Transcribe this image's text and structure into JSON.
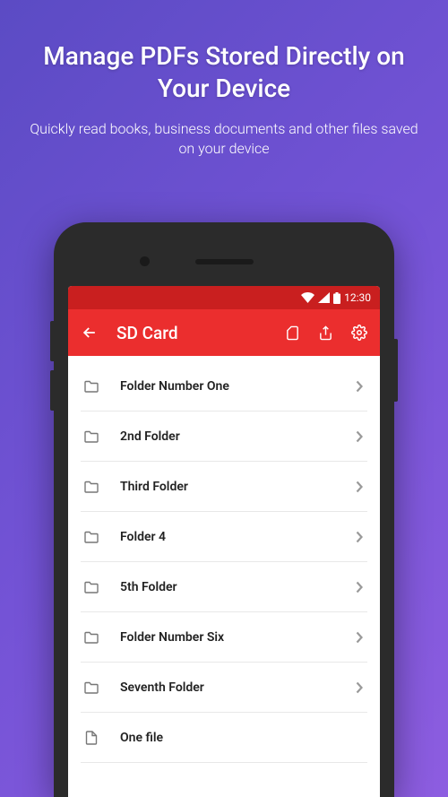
{
  "promo": {
    "title": "Manage PDFs Stored Directly on Your Device",
    "subtitle": "Quickly read books, business documents and other files saved on your device"
  },
  "statusBar": {
    "time": "12:30"
  },
  "appBar": {
    "title": "SD Card"
  },
  "items": [
    {
      "label": "Folder Number One",
      "type": "folder"
    },
    {
      "label": "2nd Folder",
      "type": "folder"
    },
    {
      "label": "Third Folder",
      "type": "folder"
    },
    {
      "label": "Folder 4",
      "type": "folder"
    },
    {
      "label": "5th Folder",
      "type": "folder"
    },
    {
      "label": "Folder Number Six",
      "type": "folder"
    },
    {
      "label": "Seventh Folder",
      "type": "folder"
    },
    {
      "label": "One file",
      "type": "file"
    }
  ]
}
